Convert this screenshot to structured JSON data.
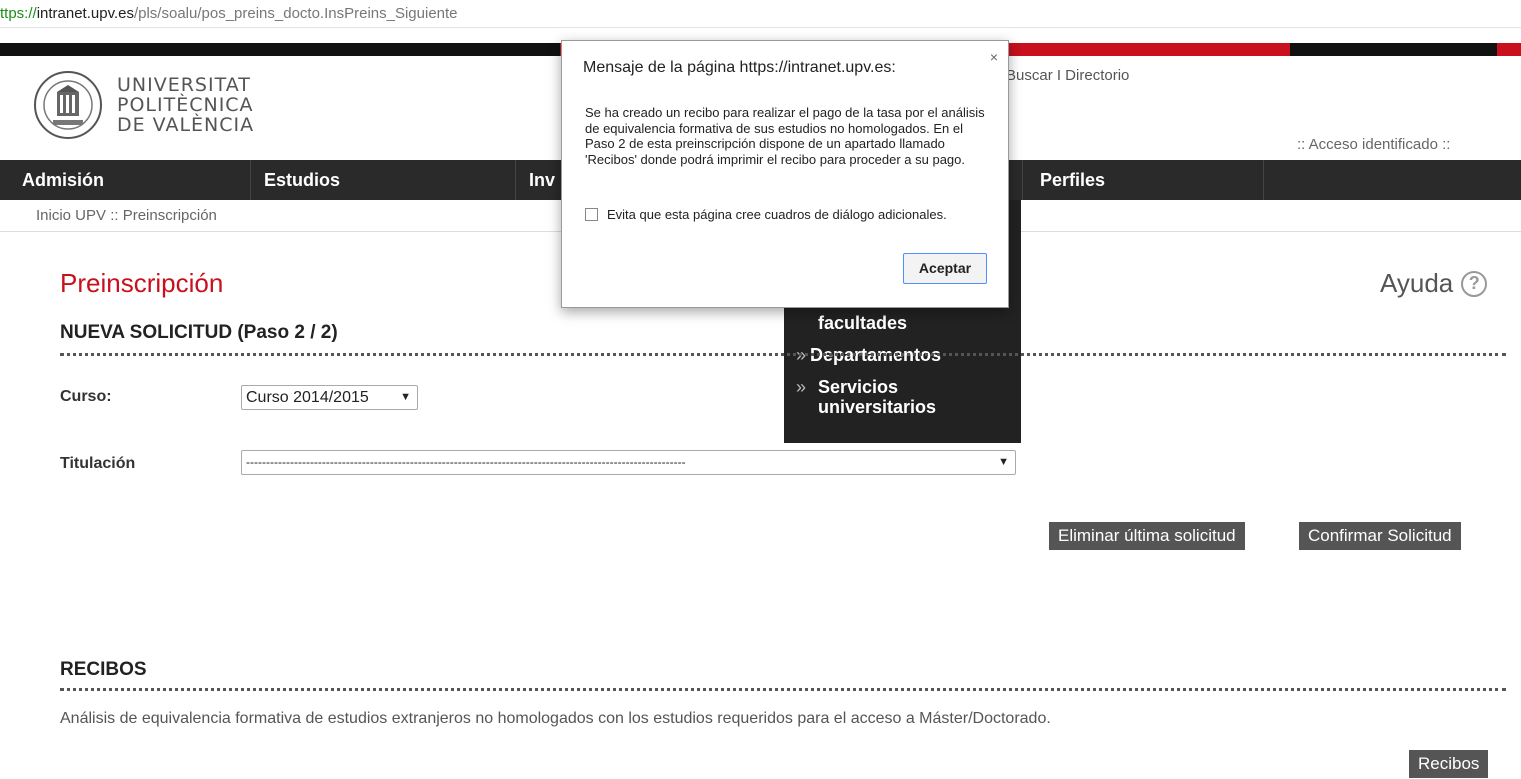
{
  "browser": {
    "url_scheme": "ttps://",
    "url_host": "intranet.upv.es",
    "url_path": "/pls/soalu/pos_preins_docto.InsPreins_Siguiente"
  },
  "header": {
    "logo_line1": "UNIVERSITAT",
    "logo_line2": "POLITÈCNICA",
    "logo_line3": "DE VALÈNCIA",
    "top_links": "Buscar I  Directorio",
    "access": ":: Acceso identificado ::"
  },
  "nav": {
    "items": [
      "Admisión",
      "Estudios",
      "Inv",
      "Perfiles"
    ]
  },
  "dropdown_menu": {
    "items": [
      "facultades",
      "Departamentos",
      "Servicios universitarios"
    ]
  },
  "breadcrumb": "Inicio UPV :: Preinscripción",
  "main": {
    "title": "Preinscripción",
    "help_label": "Ayuda",
    "help_icon_glyph": "?",
    "section_title": "NUEVA SOLICITUD (Paso 2 / 2)",
    "curso_label": "Curso:",
    "curso_value": "Curso 2014/2015",
    "titulacion_label": "Titulación",
    "titulacion_value": "--------------------------------------------------------------------------------------------------------------",
    "btn_eliminar": "Eliminar última solicitud",
    "btn_confirmar": "Confirmar Solicitud"
  },
  "recibos": {
    "title": "RECIBOS",
    "description": "Análisis de equivalencia formativa de estudios extranjeros no homologados con los estudios requeridos para el acceso a Máster/Doctorado.",
    "button": "Recibos"
  },
  "dialog": {
    "title": "Mensaje de la página https://intranet.upv.es:",
    "close": "×",
    "message": "Se ha creado un recibo para realizar el pago de la tasa por el análisis de equivalencia formativa de sus estudios no homologados. En el Paso 2 de esta preinscripción dispone de un apartado llamado 'Recibos' donde podrá imprimir el recibo para proceder a su pago.",
    "checkbox_label": "Evita que esta página cree cuadros de diálogo adicionales.",
    "accept": "Aceptar"
  },
  "colors": {
    "accent": "#c8101e",
    "nav_bg": "#2a2a2a",
    "button_bg": "#555555"
  },
  "icons": {
    "seal": "university-seal-icon",
    "help": "help-circle-icon",
    "chevron": "double-chevron-icon"
  }
}
